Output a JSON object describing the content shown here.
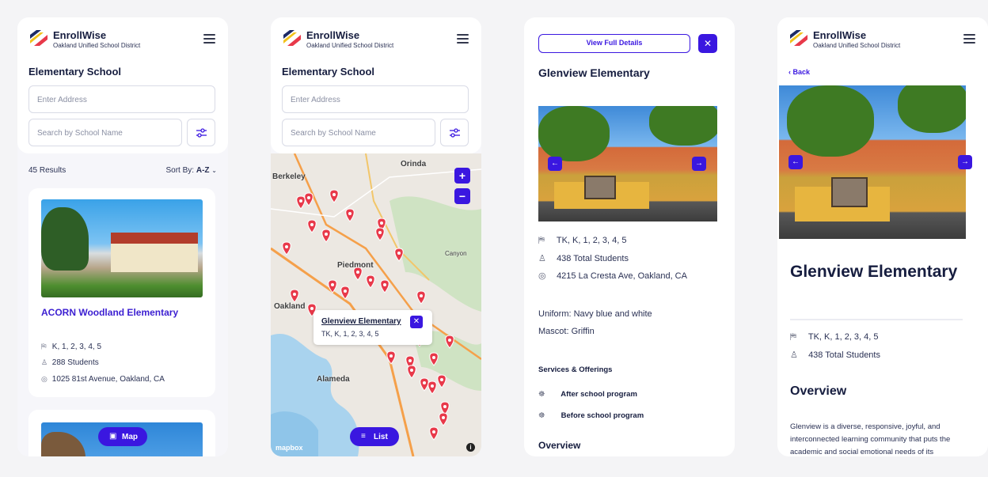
{
  "brand": {
    "name": "EnrollWise",
    "district": "Oakland Unified School District"
  },
  "colors": {
    "accent": "#3a17e0",
    "text": "#161d3f",
    "pin": "#e8394a"
  },
  "list_screen": {
    "section_title": "Elementary School",
    "address_placeholder": "Enter Address",
    "school_name_placeholder": "Search by School Name",
    "results_count": "45 Results",
    "sort_label": "Sort By:",
    "sort_value": "A-Z",
    "cards": [
      {
        "name": "ACORN Woodland Elementary",
        "grades": "K, 1, 2, 3, 4, 5",
        "students": "288 Students",
        "address": "1025 81st Avenue, Oakland, CA"
      }
    ],
    "map_button": "Map"
  },
  "map_screen": {
    "section_title": "Elementary School",
    "address_placeholder": "Enter Address",
    "school_name_placeholder": "Search by School Name",
    "zoom_in": "+",
    "zoom_out": "−",
    "labels": [
      "Berkeley",
      "Orinda",
      "Piedmont",
      "Oakland",
      "Alameda",
      "Canyon"
    ],
    "popup": {
      "name": "Glenview Elementary",
      "grades": "TK, K, 1, 2, 3, 4, 5"
    },
    "list_button": "List",
    "attribution": "mapbox",
    "info": "i"
  },
  "detail_screen": {
    "view_full_details": "View Full Details",
    "close": "✕",
    "school_name": "Glenview Elementary",
    "grades": "TK, K, 1, 2, 3, 4, 5",
    "students": "438 Total Students",
    "address": "4215 La Cresta Ave, Oakland, CA",
    "uniform": "Uniform: Navy blue and white",
    "mascot": "Mascot: Griffin",
    "services_title": "Services & Offerings",
    "services": [
      "After school program",
      "Before school program"
    ],
    "overview_title": "Overview"
  },
  "full_screen": {
    "back": "Back",
    "school_name": "Glenview Elementary",
    "grades": "TK, K, 1, 2, 3, 4, 5",
    "students": "438 Total Students",
    "overview_title": "Overview",
    "overview_text": "Glenview is a diverse, responsive, joyful, and interconnected learning community that puts the academic and social emotional needs of its"
  },
  "icons": [
    "logo-icon",
    "hamburger-icon",
    "filter-icon",
    "chevron-down-icon",
    "grade-icon",
    "student-icon",
    "location-icon",
    "map-icon",
    "list-icon",
    "arrow-left-icon",
    "arrow-right-icon",
    "service-icon",
    "close-icon",
    "back-chevron-icon",
    "map-pin-icon"
  ]
}
